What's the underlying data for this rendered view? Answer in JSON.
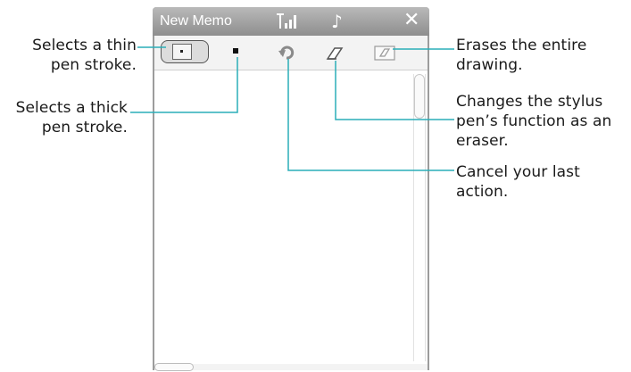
{
  "window": {
    "title": "New Memo",
    "icons": [
      "signal-strength-icon",
      "music-note-icon",
      "close-icon"
    ],
    "close_glyph": "✕",
    "music_glyph": "♪"
  },
  "toolbar": {
    "tools": [
      "thin-pen",
      "thick-pen",
      "undo",
      "eraser",
      "clear-all"
    ]
  },
  "callouts": {
    "thin_pen": [
      "Selects a thin",
      "pen stroke."
    ],
    "thick_pen": [
      "Selects a thick",
      "pen stroke."
    ],
    "clear_all": [
      "Erases the entire",
      "drawing."
    ],
    "eraser": [
      "Changes the stylus",
      "pen’s function as an",
      "eraser."
    ],
    "undo": [
      "Cancel your last",
      "action."
    ]
  },
  "colors": {
    "leader_line": "#2aaeb8",
    "titlebar": "#a4a4a4"
  }
}
